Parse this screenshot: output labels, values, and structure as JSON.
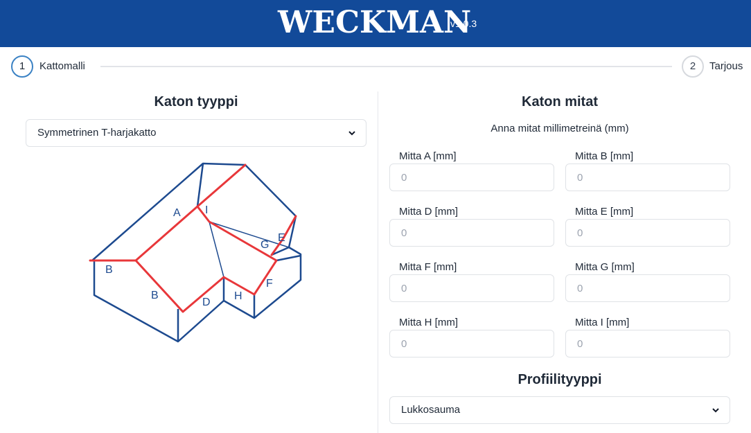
{
  "header": {
    "logo": "WECKMAN",
    "version": "v1.0.3",
    "background_color": "#124a99"
  },
  "stepper": {
    "steps": [
      {
        "number": "1",
        "label": "Kattomalli",
        "active": true
      },
      {
        "number": "2",
        "label": "Tarjous",
        "active": false
      }
    ]
  },
  "roof_type": {
    "title": "Katon tyyppi",
    "selected": "Symmetrinen T-harjakatto",
    "diagram_labels": {
      "A": "A",
      "B_left": "B",
      "B_front": "B",
      "D": "D",
      "E": "E",
      "F": "F",
      "G": "G",
      "H": "H",
      "I": "I"
    },
    "diagram_colors": {
      "outline": "#1d4a8f",
      "highlight": "#e8373a"
    }
  },
  "dimensions": {
    "title": "Katon mitat",
    "subtitle": "Anna mitat millimetreinä (mm)",
    "fields": [
      {
        "label": "Mitta A [mm]",
        "placeholder": "0"
      },
      {
        "label": "Mitta B [mm]",
        "placeholder": "0"
      },
      {
        "label": "Mitta D [mm]",
        "placeholder": "0"
      },
      {
        "label": "Mitta E [mm]",
        "placeholder": "0"
      },
      {
        "label": "Mitta F [mm]",
        "placeholder": "0"
      },
      {
        "label": "Mitta G [mm]",
        "placeholder": "0"
      },
      {
        "label": "Mitta H [mm]",
        "placeholder": "0"
      },
      {
        "label": "Mitta I [mm]",
        "placeholder": "0"
      }
    ]
  },
  "profile": {
    "title": "Profiilityyppi",
    "selected": "Lukkosauma"
  },
  "accent_color": "#3b82c4"
}
